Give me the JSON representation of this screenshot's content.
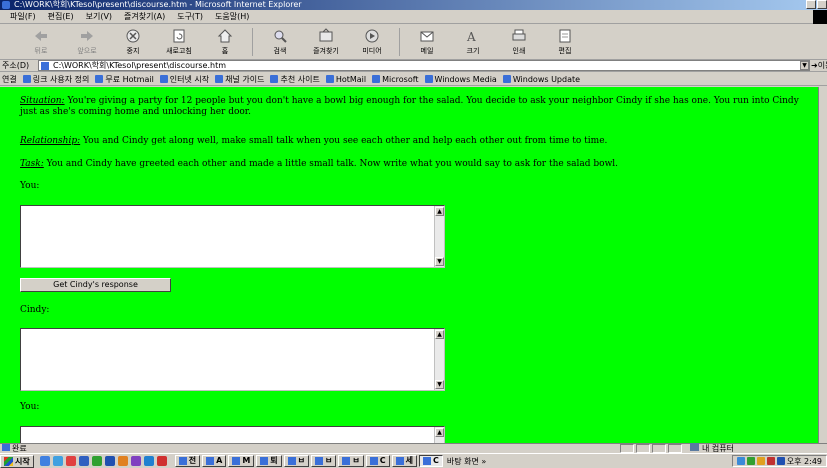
{
  "window": {
    "title": "C:\\WORK\\학회\\KTesol\\present\\discourse.htm - Microsoft Internet Explorer"
  },
  "menu": [
    "파일(F)",
    "편집(E)",
    "보기(V)",
    "즐겨찾기(A)",
    "도구(T)",
    "도움말(H)"
  ],
  "toolbar": [
    {
      "label": "뒤로",
      "icon": "back-arrow-icon",
      "disabled": true
    },
    {
      "label": "앞으로",
      "icon": "forward-arrow-icon",
      "disabled": true
    },
    {
      "label": "중지",
      "icon": "stop-icon",
      "disabled": false
    },
    {
      "label": "새로고침",
      "icon": "refresh-icon",
      "disabled": false
    },
    {
      "label": "홈",
      "icon": "home-icon",
      "disabled": false
    },
    {
      "label": "검색",
      "icon": "search-icon",
      "disabled": false
    },
    {
      "label": "즐겨찾기",
      "icon": "favorites-icon",
      "disabled": false
    },
    {
      "label": "미디어",
      "icon": "media-icon",
      "disabled": false
    },
    {
      "label": "메일",
      "icon": "mail-icon",
      "disabled": false
    },
    {
      "label": "크기",
      "icon": "font-size-icon",
      "disabled": false
    },
    {
      "label": "인쇄",
      "icon": "print-icon",
      "disabled": false
    },
    {
      "label": "편집",
      "icon": "edit-icon",
      "disabled": false
    }
  ],
  "address": {
    "label": "주소(D)",
    "value": "C:\\WORK\\학회\\KTesol\\present\\discourse.htm",
    "go_label": "이동"
  },
  "links": {
    "label": "연결",
    "items": [
      "링크 사용자 정의",
      "무료 Hotmail",
      "인터넷 시작",
      "채널 가이드",
      "추천 사이트",
      "HotMail",
      "Microsoft",
      "Windows Media",
      "Windows Update"
    ]
  },
  "page": {
    "situation_tag": "Situation:",
    "situation_text": " You're giving a party for 12 people but you don't have a bowl big enough for the salad. You decide to ask your neighbor Cindy if she has one. You run into Cindy just as she's coming home and unlocking her door.",
    "relationship_tag": "Relationship:",
    "relationship_text": " You and Cindy get along well, make small talk when you see each other and help each other out from time to time.",
    "task_tag": "Task:",
    "task_text": " You and Cindy have greeted each other and made a little small talk. Now write what you would say to ask for the salad bowl.",
    "you_label_1": "You:",
    "response_button": "Get Cindy's response",
    "cindy_label": "Cindy:",
    "you_label_2": "You:",
    "colors": {
      "background": "#00ff00"
    }
  },
  "status": {
    "text": "완료",
    "zone": "내 컴퓨터"
  },
  "taskbar": {
    "start_label": "시작",
    "tasks": [
      "전",
      "A",
      "M",
      "퇴",
      "ㅂ",
      "ㅂ",
      "ㅂ",
      "C",
      "세",
      "C"
    ],
    "desktop_label": "바탕 화면 »",
    "clock": "오후 2:49"
  }
}
